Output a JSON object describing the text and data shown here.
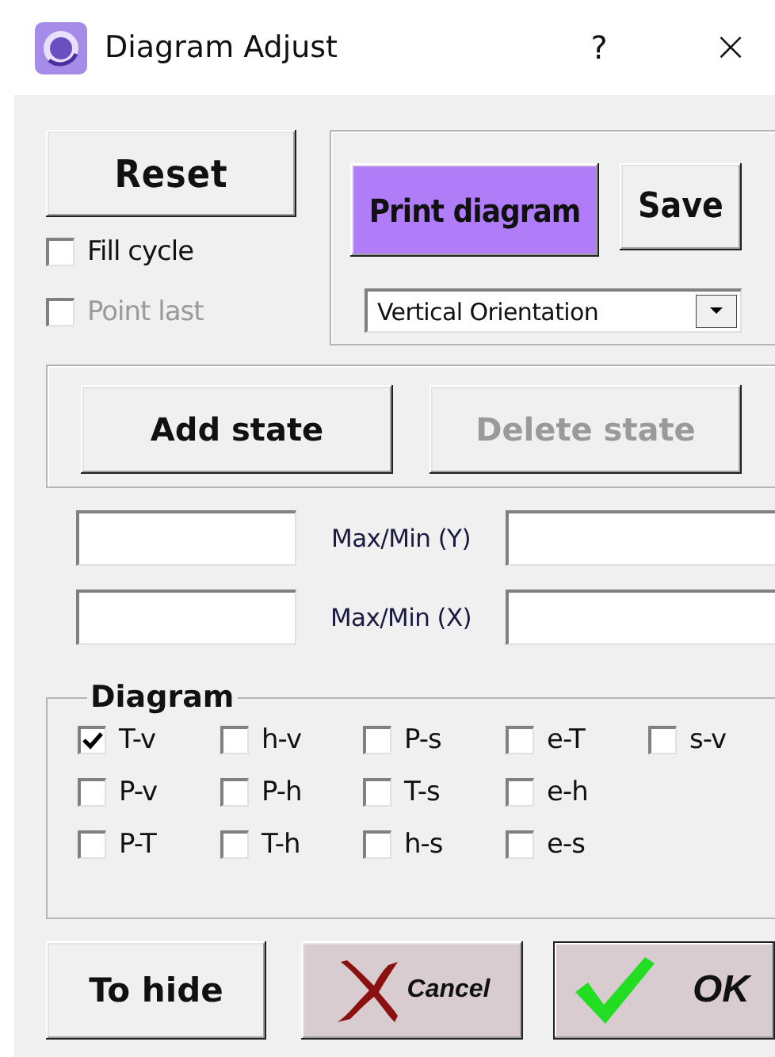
{
  "window": {
    "title": "Diagram Adjust",
    "help": "?",
    "close": "×"
  },
  "reset_button": {
    "label": "Reset"
  },
  "options": [
    {
      "label": "Fill cycle",
      "checked": false,
      "disabled": false
    },
    {
      "label": "Point last",
      "checked": false,
      "disabled": true
    }
  ],
  "print_button": {
    "label": "Print diagram"
  },
  "save_button": {
    "label": "Save"
  },
  "orientation": {
    "value": "Vertical Orientation"
  },
  "state_buttons": [
    {
      "label": "Add state",
      "disabled": false
    },
    {
      "label": "Delete state",
      "disabled": true
    }
  ],
  "ranges": [
    {
      "label": "Max/Min (Y)"
    },
    {
      "label": "Max/Min (X)"
    }
  ],
  "diagram": {
    "title": "Diagram",
    "rows": [
      [
        {
          "label": "T-v",
          "checked": true
        },
        {
          "label": "h-v",
          "checked": false
        },
        {
          "label": "P-s",
          "checked": false
        },
        {
          "label": "e-T",
          "checked": false
        },
        {
          "label": "s-v",
          "checked": false
        }
      ],
      [
        {
          "label": "P-v",
          "checked": false
        },
        {
          "label": "P-h",
          "checked": false
        },
        {
          "label": "T-s",
          "checked": false
        },
        {
          "label": "e-h",
          "checked": false
        }
      ],
      [
        {
          "label": "P-T",
          "checked": false
        },
        {
          "label": "T-h",
          "checked": false
        },
        {
          "label": "h-s",
          "checked": false
        },
        {
          "label": "e-s",
          "checked": false
        }
      ]
    ]
  },
  "footer_buttons": [
    {
      "kind": "text",
      "label": "To hide"
    },
    {
      "kind": "cancel",
      "label": "Cancel"
    },
    {
      "kind": "ok",
      "label": "OK"
    }
  ]
}
